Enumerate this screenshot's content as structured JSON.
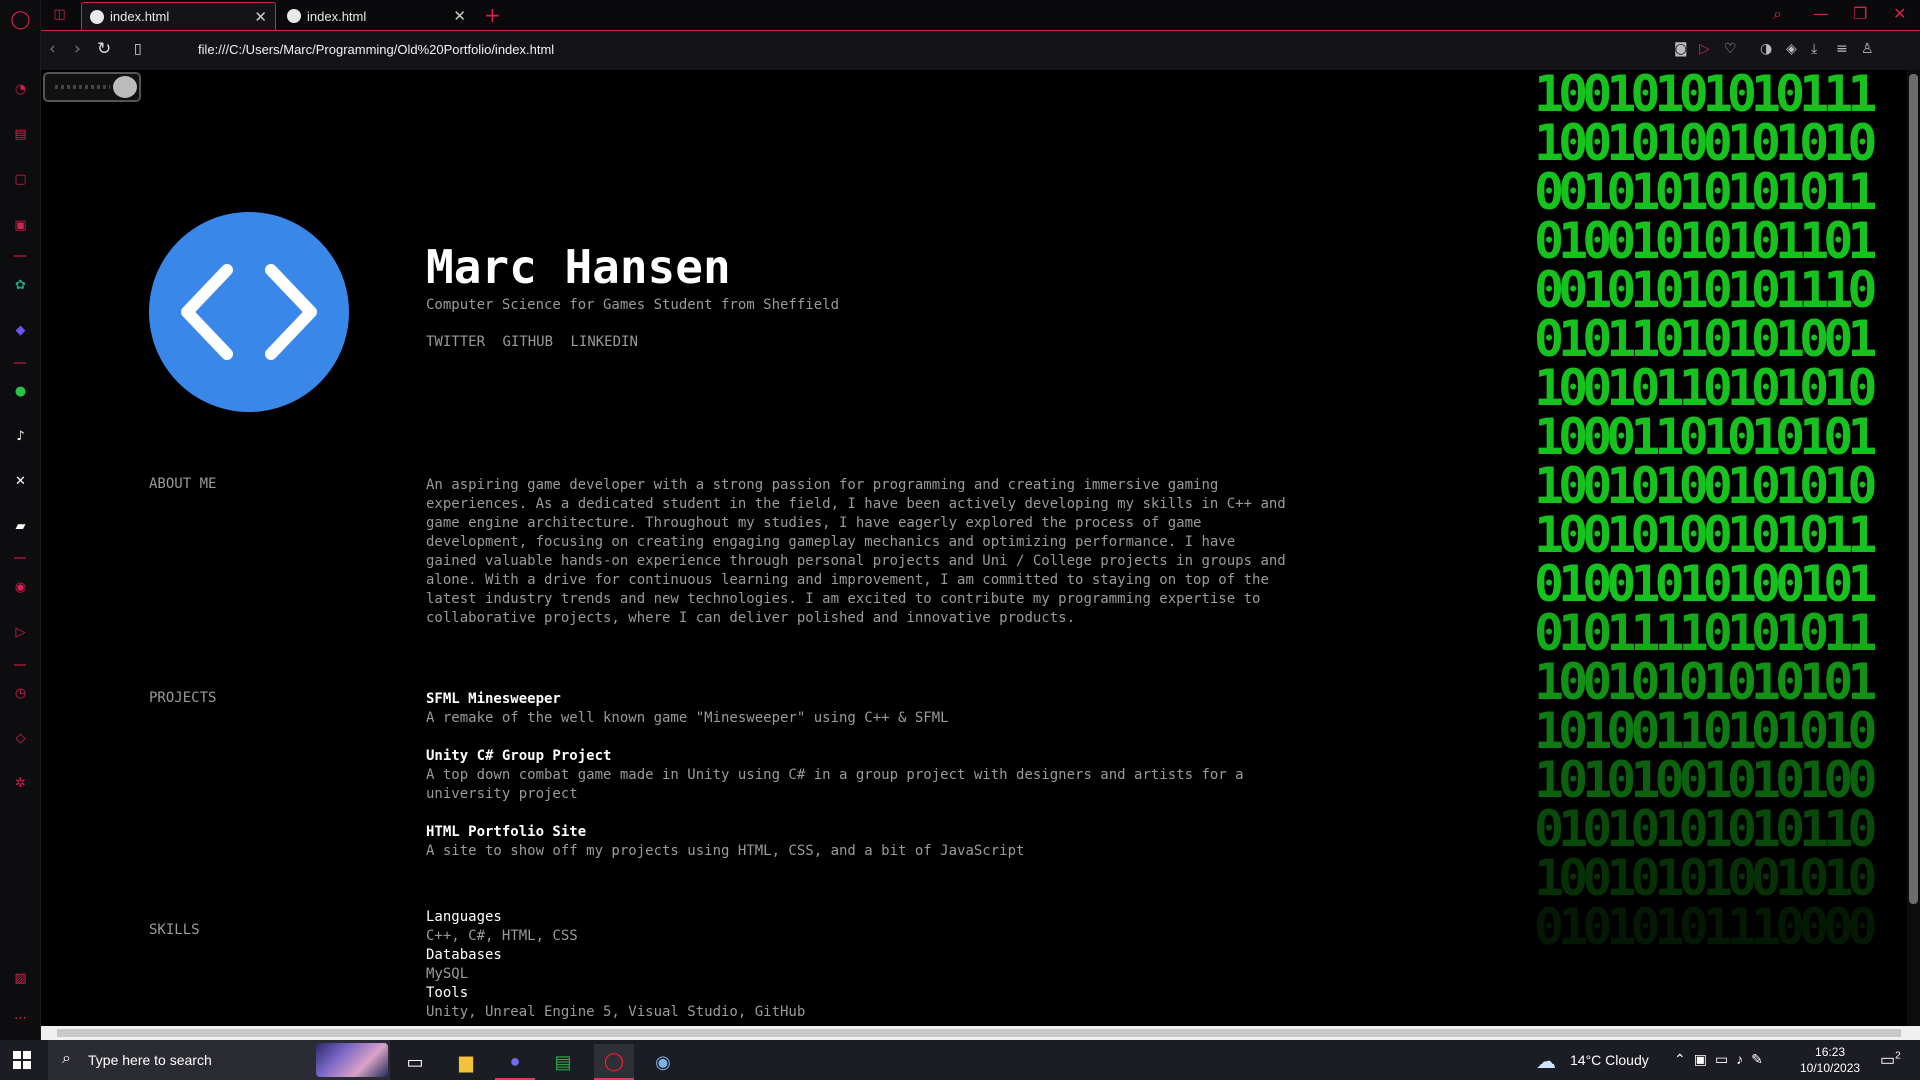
{
  "browser": {
    "tabs": [
      {
        "label": "index.html",
        "active": true
      },
      {
        "label": "index.html",
        "active": false
      }
    ],
    "url": "file:///C:/Users/Marc/Programming/Old%20Portfolio/index.html"
  },
  "page": {
    "name": "Marc Hansen",
    "subtitle": "Computer Science for Games Student from Sheffield",
    "social_links": [
      "TWITTER",
      "GITHUB",
      "LINKEDIN"
    ],
    "about": {
      "label": "ABOUT ME",
      "lines": [
        "An aspiring game developer with a strong passion for programming and creating immersive gaming",
        "experiences. As a dedicated student in the field, I have been actively developing my skills in C++ and",
        "game engine architecture. Throughout my studies, I have eagerly explored the process of game",
        "development, focusing on creating engaging gameplay mechanics and optimizing performance. I have",
        "gained valuable hands-on experience through personal projects and Uni / College projects in groups and",
        "alone. With a drive for continuous learning and improvement, I am committed to staying on top of the",
        "latest industry trends and new technologies. I am excited to contribute my programming expertise to",
        "collaborative projects, where I can deliver polished and innovative products."
      ]
    },
    "projects": {
      "label": "PROJECTS",
      "items": [
        {
          "title": "SFML Minesweeper",
          "lines": [
            "A remake of the well known game \"Minesweeper\" using C++ & SFML"
          ]
        },
        {
          "title": "Unity C# Group Project",
          "lines": [
            "A top down combat game made in Unity using C# in a group project with designers and artists for a",
            "university project"
          ]
        },
        {
          "title": "HTML Portfolio Site",
          "lines": [
            "A site to show off my projects using HTML, CSS, and a bit of JavaScript"
          ]
        }
      ]
    },
    "skills": {
      "label": "SKILLS",
      "categories": [
        {
          "name": "Languages",
          "value": "C++, C#, HTML, CSS"
        },
        {
          "name": "Databases",
          "value": "MySQL"
        },
        {
          "name": "Tools",
          "value": "Unity, Unreal Engine 5, Visual Studio, GitHub"
        }
      ]
    },
    "binary_rows": [
      "10010101010111",
      "10010100101010",
      "00101010101011",
      "01001010101101",
      "00101010101110",
      "01011010101001",
      "10010110101010",
      "10001101010101",
      "10010100101010",
      "10010100101011",
      "01001010100101",
      "01011110101011",
      "10010101010101",
      "10100110101010",
      "10101001010100",
      "01010101010110",
      "10010101001010",
      "01010101110000"
    ],
    "matrix_color": "#18c21e",
    "logo_color": "#3a87ea"
  },
  "taskbar": {
    "search_placeholder": "Type here to search",
    "weather": "14°C  Cloudy",
    "time": "16:23",
    "date": "10/10/2023",
    "notification_count": "2"
  },
  "colors": {
    "accent": "#d6204e"
  }
}
